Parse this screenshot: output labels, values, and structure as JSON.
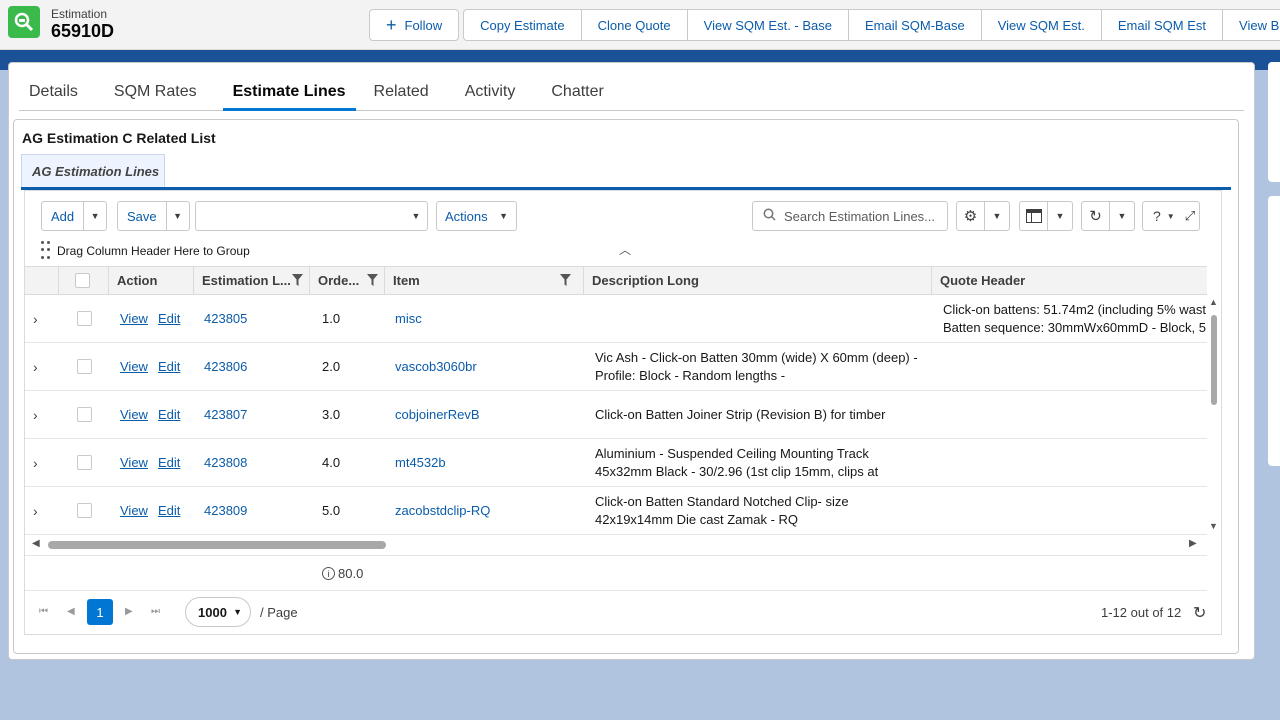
{
  "record": {
    "object_label": "Estimation",
    "name": "65910D"
  },
  "header_buttons": {
    "follow": "Follow",
    "actions": [
      "Copy Estimate",
      "Clone Quote",
      "View SQM Est. - Base",
      "Email SQM-Base",
      "View SQM Est.",
      "Email SQM Est",
      "View BOQ"
    ]
  },
  "tabs": [
    "Details",
    "SQM Rates",
    "Estimate Lines",
    "Related",
    "Activity",
    "Chatter"
  ],
  "active_tab": "Estimate Lines",
  "related_list": {
    "title": "AG Estimation C Related List",
    "subtab": "AG Estimation Lines"
  },
  "toolbar": {
    "add": "Add",
    "save": "Save",
    "view_select_value": "",
    "actions": "Actions",
    "search_placeholder": "Search Estimation Lines...",
    "help": "?"
  },
  "group_bar_text": "Drag Column Header Here to Group",
  "columns": [
    "",
    "",
    "Action",
    "Estimation L...",
    "Orde...",
    "Item",
    "Description Long",
    "Quote Header"
  ],
  "rows": [
    {
      "view": "View",
      "edit": "Edit",
      "est": "423805",
      "order": "1.0",
      "item": "misc",
      "desc": "",
      "qh": "Click-on battens: 51.74m2 (including 5% wast\nBatten sequence: 30mmWx60mmD - Block, 5"
    },
    {
      "view": "View",
      "edit": "Edit",
      "est": "423806",
      "order": "2.0",
      "item": "vascob3060br",
      "desc": "Vic Ash - Click-on Batten 30mm (wide) X 60mm (deep) - Profile: Block - Random lengths -",
      "qh": ""
    },
    {
      "view": "View",
      "edit": "Edit",
      "est": "423807",
      "order": "3.0",
      "item": "cobjoinerRevB",
      "desc": "Click-on Batten Joiner Strip (Revision B) for timber",
      "qh": ""
    },
    {
      "view": "View",
      "edit": "Edit",
      "est": "423808",
      "order": "4.0",
      "item": "mt4532b",
      "desc": "Aluminium - Suspended Ceiling Mounting Track 45x32mm Black - 30/2.96 (1st clip 15mm, clips at",
      "qh": ""
    },
    {
      "view": "View",
      "edit": "Edit",
      "est": "423809",
      "order": "5.0",
      "item": "zacobstdclip-RQ",
      "desc": "Click-on Batten Standard Notched Clip- size 42x19x14mm Die cast Zamak - RQ",
      "qh": ""
    }
  ],
  "aggregate": "80.0",
  "pager": {
    "current_page": "1",
    "page_size": "1000",
    "per_page_label": "/ Page",
    "count_label": "1-12 out of 12"
  },
  "colors": {
    "brand_blue": "#0176d3",
    "link_blue": "#0b5cab",
    "band_blue": "#1b5297",
    "icon_green": "#3bba4c"
  }
}
